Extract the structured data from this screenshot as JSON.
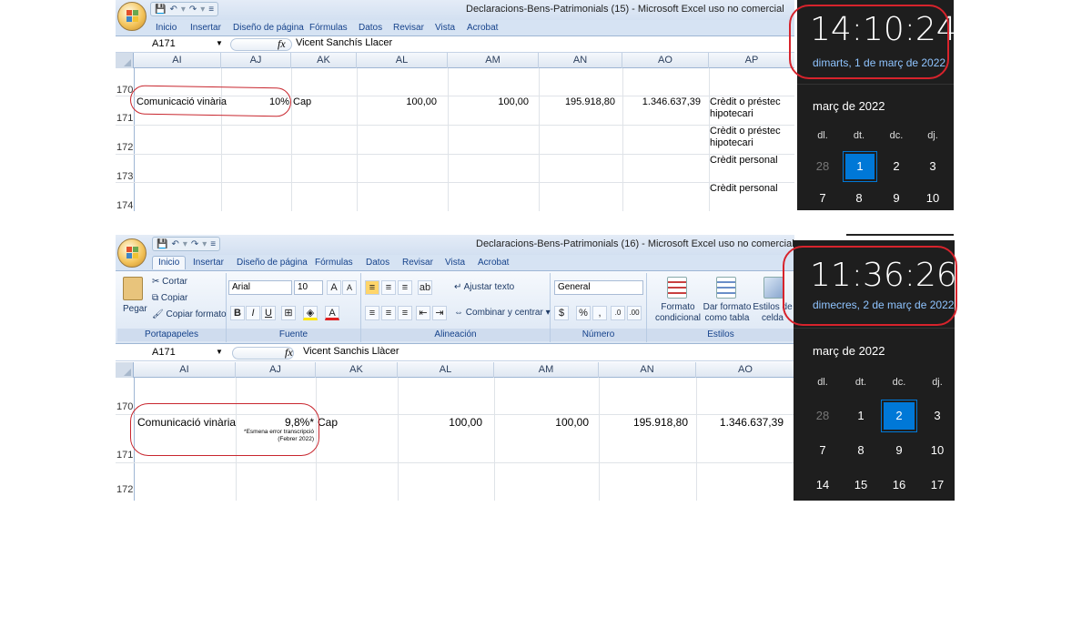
{
  "top": {
    "title": "Declaracions-Bens-Patrimonials (15) - Microsoft Excel uso no comercial",
    "tabs": [
      "Inicio",
      "Insertar",
      "Diseño de página",
      "Fórmulas",
      "Datos",
      "Revisar",
      "Vista",
      "Acrobat"
    ],
    "namebox": "A171",
    "formula": "Vicent Sanchís Llacer",
    "columns": [
      "AI",
      "AJ",
      "AK",
      "AL",
      "AM",
      "AN",
      "AO",
      "AP"
    ],
    "rows": [
      {
        "num": "170",
        "cells": {}
      },
      {
        "num": "171",
        "cells": {
          "AI": "Comunicació vinària",
          "AJ": "10%",
          "AK": "Cap",
          "AL": "100,00",
          "AM": "100,00",
          "AN": "195.918,80",
          "AO": "1.346.637,39",
          "AP": "Crèdit o préstec hipotecari"
        }
      },
      {
        "num": "172",
        "cells": {
          "AP": "Crèdit o préstec hipotecari"
        }
      },
      {
        "num": "173",
        "cells": {
          "AP": "Crèdit personal"
        }
      },
      {
        "num": "174",
        "cells": {
          "AP": "Crèdit personal"
        }
      }
    ]
  },
  "bottom": {
    "title": "Declaracions-Bens-Patrimonials (16) - Microsoft Excel uso no comercial",
    "tabs": [
      "Inicio",
      "Insertar",
      "Diseño de página",
      "Fórmulas",
      "Datos",
      "Revisar",
      "Vista",
      "Acrobat"
    ],
    "ribbon": {
      "paste": "Pegar",
      "cut": "Cortar",
      "copy": "Copiar",
      "copy_format": "Copiar formato",
      "font_name": "Arial",
      "font_size": "10",
      "wrap_text": "Ajustar texto",
      "merge_center": "Combinar y centrar",
      "number_format": "General",
      "cond_format_1": "Formato",
      "cond_format_2": "condicional",
      "table_format_1": "Dar formato",
      "table_format_2": "como tabla",
      "cell_styles_1": "Estilos de",
      "cell_styles_2": "celda",
      "groups": [
        "Portapapeles",
        "Fuente",
        "Alineación",
        "Número",
        "Estilos"
      ]
    },
    "namebox": "A171",
    "formula": "Vicent Sanchis Llàcer",
    "columns": [
      "AI",
      "AJ",
      "AK",
      "AL",
      "AM",
      "AN",
      "AO"
    ],
    "rows": [
      {
        "num": "170",
        "cells": {}
      },
      {
        "num": "171",
        "cells": {
          "AI": "Comunicació vinària",
          "AJ": "9,8%*",
          "AJ_note": "*Esmena error transcripció (Febrer 2022)",
          "AK": "Cap",
          "AL": "100,00",
          "AM": "100,00",
          "AN": "195.918,80",
          "AO": "1.346.637,39"
        }
      },
      {
        "num": "172",
        "cells": {}
      }
    ]
  },
  "clock_top": {
    "time": "14:10:24",
    "date": "dimarts, 1 de març de 2022",
    "month": "març de 2022",
    "weekdays": [
      "dl.",
      "dt.",
      "dc.",
      "dj."
    ],
    "week1": [
      "28",
      "1",
      "2",
      "3"
    ],
    "week2": [
      "7",
      "8",
      "9",
      "10"
    ]
  },
  "clock_bottom": {
    "time": "11:36:26",
    "date": "dimecres, 2 de març de 2022",
    "month": "març de 2022",
    "weekdays": [
      "dl.",
      "dt.",
      "dc.",
      "dj."
    ],
    "week1": [
      "28",
      "1",
      "2",
      "3"
    ],
    "week2": [
      "7",
      "8",
      "9",
      "10"
    ],
    "week3": [
      "14",
      "15",
      "16",
      "17"
    ]
  },
  "colors": {
    "accent_red": "#c8262e",
    "calendar_selected": "#0078d7",
    "clock_bg": "#1e1e1e",
    "date_blue": "#8fc4ff"
  }
}
